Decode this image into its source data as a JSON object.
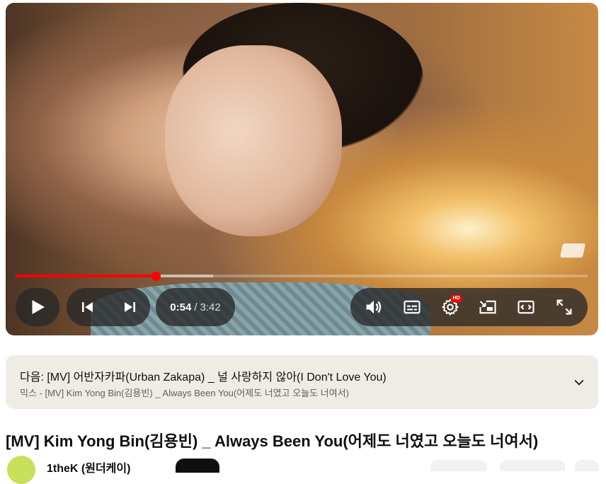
{
  "player": {
    "progress": {
      "played_fraction": 0.245,
      "buffered_fraction": 0.345
    },
    "current_time": "0:54",
    "separator": "/",
    "duration": "3:42",
    "settings_badge": "HD",
    "icons": {
      "play": "play-icon",
      "previous": "skip-previous-icon",
      "next": "skip-next-icon",
      "volume": "volume-icon",
      "subtitles": "subtitles-icon",
      "settings": "gear-icon",
      "miniplayer": "miniplayer-icon",
      "theater": "theater-mode-icon",
      "fullscreen": "fullscreen-icon"
    }
  },
  "up_next": {
    "line1": "다음: [MV] 어반자카파(Urban Zakapa) _ 널 사랑하지 않아(I Don't Love You)",
    "line2": "믹스 - [MV] Kim Yong Bin(김용빈) _ Always Been You(어제도 너였고 오늘도 너여서)"
  },
  "video": {
    "title": "[MV] Kim Yong Bin(김용빈) _ Always Been You(어제도 너였고 오늘도 너여서)"
  },
  "channel": {
    "name": "1theK (원더케이)"
  },
  "colors": {
    "accent": "#ff0000",
    "up_next_bg": "#efece6",
    "control_bg": "#282828"
  }
}
